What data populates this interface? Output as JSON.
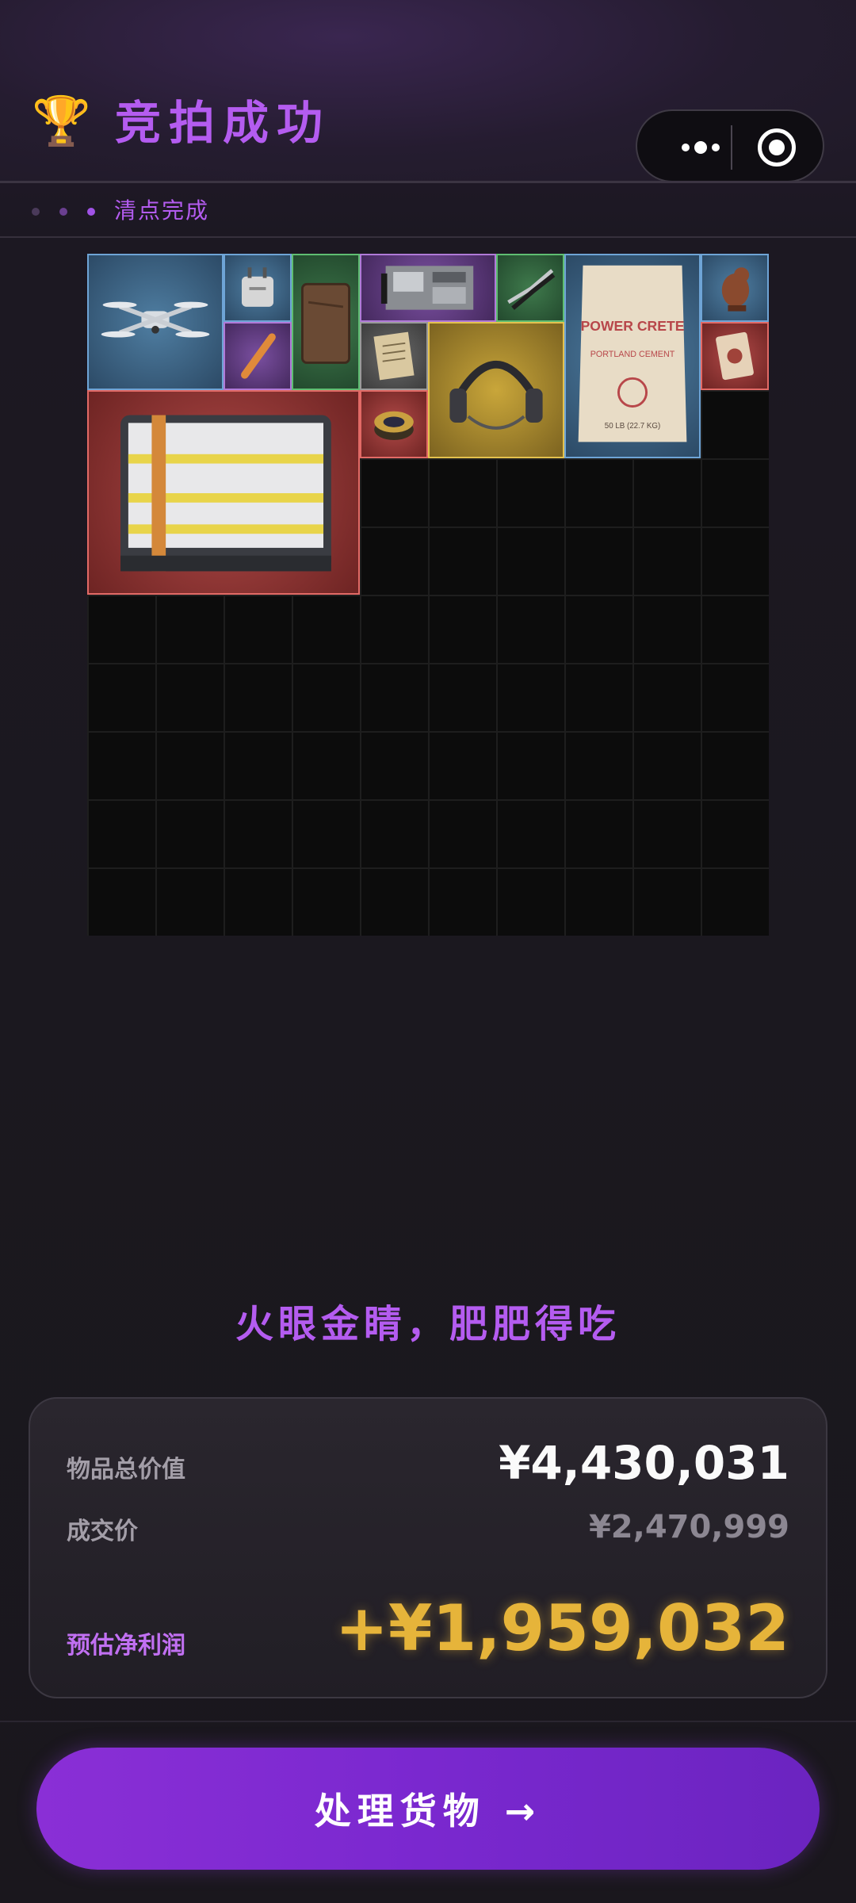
{
  "header": {
    "trophy_icon": "🏆",
    "title": "竞拍成功",
    "capsule": {
      "more_icon": "more-dots-icon",
      "target_icon": "target-icon"
    }
  },
  "status": {
    "dots": [
      "#4a3a5a",
      "#6a3f90",
      "#a052e6"
    ],
    "text": "清点完成"
  },
  "inventory": {
    "columns": 10,
    "rows": 10,
    "items": [
      {
        "name": "drone",
        "rarity": "blue"
      },
      {
        "name": "travel-adapter",
        "rarity": "blue"
      },
      {
        "name": "leather-journal",
        "rarity": "green"
      },
      {
        "name": "circuit-board",
        "rarity": "purple"
      },
      {
        "name": "pliers",
        "rarity": "green"
      },
      {
        "name": "cement-bag",
        "rarity": "blue",
        "label_top": "POWER CRETE",
        "label_mid": "PORTLAND CEMENT",
        "label_bot": "50 LB (22.7 KG)"
      },
      {
        "name": "bird-figurine",
        "rarity": "blue"
      },
      {
        "name": "tube",
        "rarity": "purple"
      },
      {
        "name": "old-document",
        "rarity": "gray"
      },
      {
        "name": "headset",
        "rarity": "gold"
      },
      {
        "name": "card",
        "rarity": "red"
      },
      {
        "name": "battery-pack",
        "rarity": "red"
      },
      {
        "name": "caviar-tin",
        "rarity": "red"
      }
    ]
  },
  "slogan": "火眼金睛，肥肥得吃",
  "summary": {
    "total_label": "物品总价值",
    "total_value": "¥4,430,031",
    "deal_label": "成交价",
    "deal_value": "¥2,470,999",
    "profit_label": "预估净利润",
    "profit_value": "+¥1,959,032"
  },
  "cta": {
    "label": "处理货物 →"
  }
}
